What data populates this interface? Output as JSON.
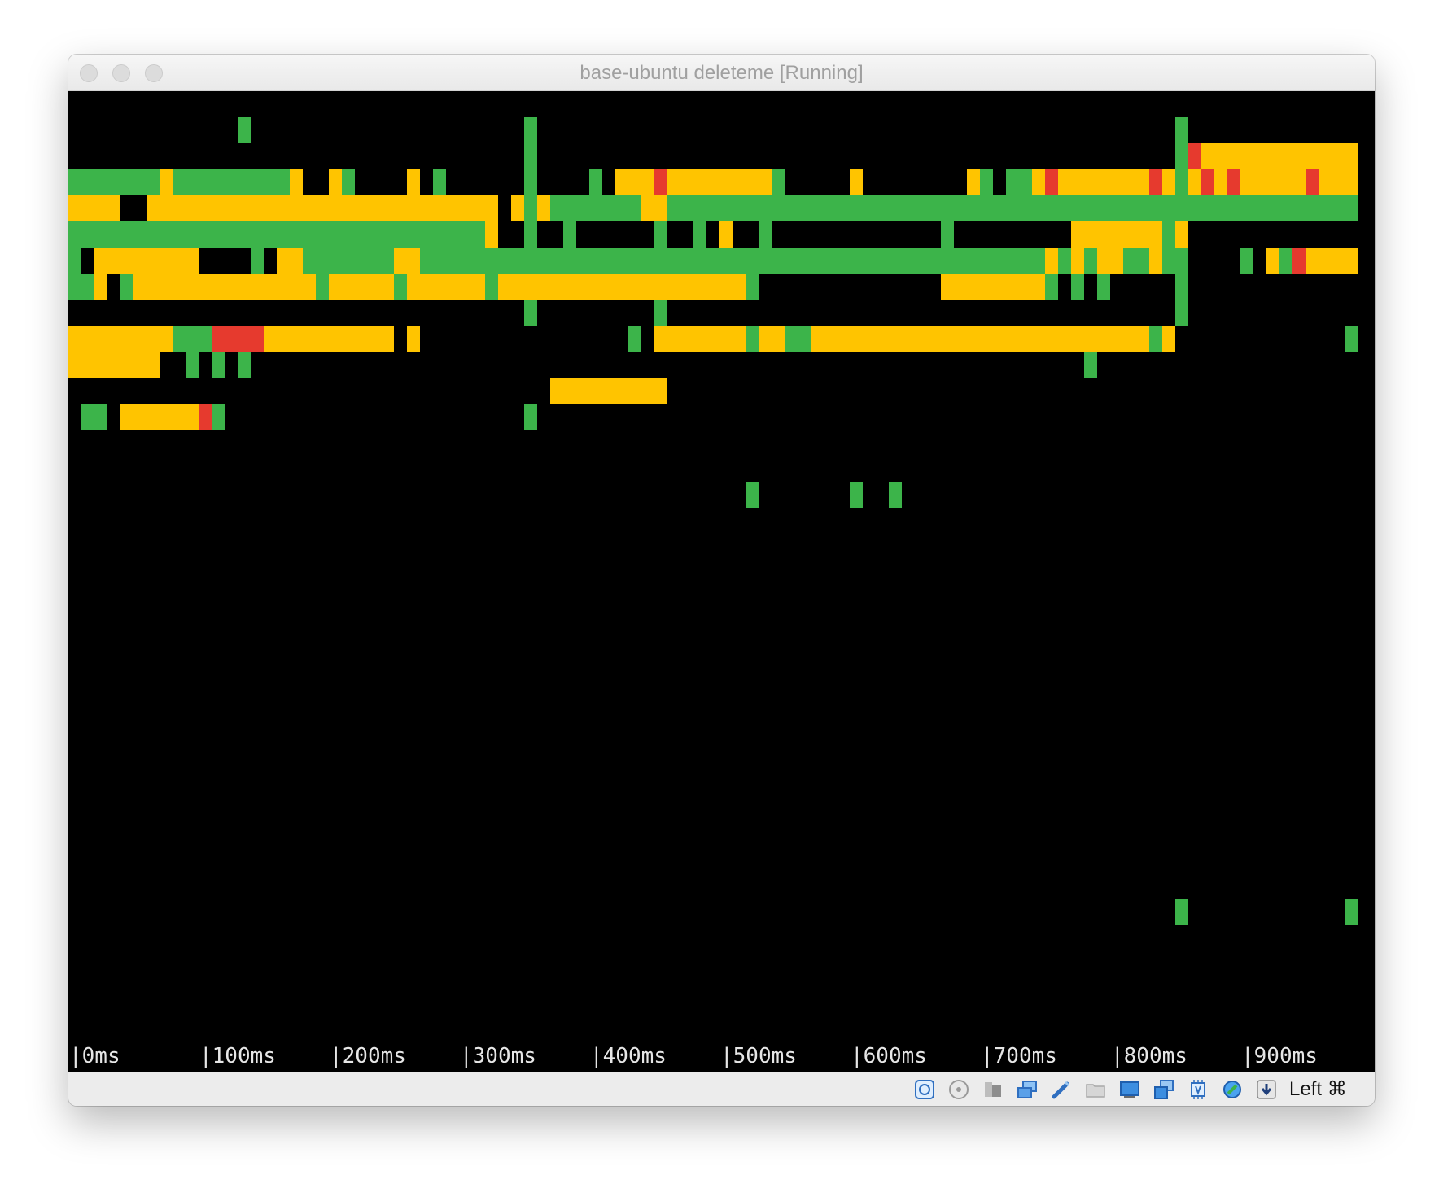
{
  "window": {
    "title": "base-ubuntu deleteme [Running]"
  },
  "colors": {
    "green": "#3cb44a",
    "yellow": "#ffc400",
    "red": "#e63a2e",
    "background": "#000000"
  },
  "timeline": {
    "ticks": [
      "|0ms",
      "|100ms",
      "|200ms",
      "|300ms",
      "|400ms",
      "|500ms",
      "|600ms",
      "|700ms",
      "|800ms",
      "|900ms"
    ]
  },
  "statusbar": {
    "icons": [
      "hard-disk-icon",
      "optical-drive-icon",
      "audio-icon",
      "network-icon",
      "usb-icon",
      "shared-folders-icon",
      "display-icon",
      "video-capture-icon",
      "cpu-icon",
      "mouse-integration-icon",
      "download-icon"
    ],
    "host_key": "Left ⌘"
  }
}
